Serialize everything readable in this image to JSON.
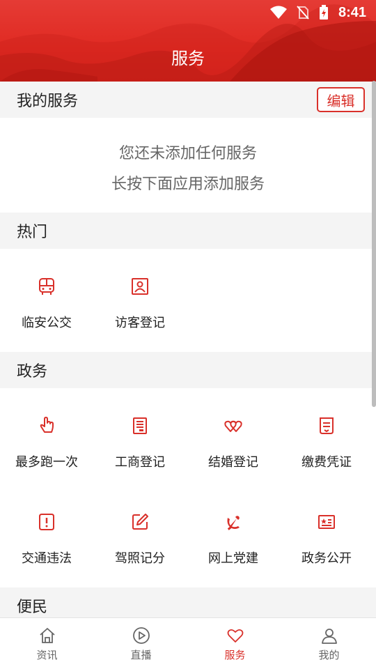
{
  "status": {
    "time": "8:41"
  },
  "header": {
    "title": "服务"
  },
  "my_services": {
    "title": "我的服务",
    "edit_label": "编辑",
    "empty_line1": "您还未添加任何服务",
    "empty_line2": "长按下面应用添加服务"
  },
  "hot": {
    "title": "热门",
    "items": [
      {
        "label": "临安公交",
        "icon": "bus-icon"
      },
      {
        "label": "访客登记",
        "icon": "visitor-card-icon"
      }
    ]
  },
  "gov": {
    "title": "政务",
    "items": [
      {
        "label": "最多跑一次",
        "icon": "tap-hand-icon"
      },
      {
        "label": "工商登记",
        "icon": "document-icon"
      },
      {
        "label": "结婚登记",
        "icon": "hearts-icon"
      },
      {
        "label": "缴费凭证",
        "icon": "receipt-icon"
      },
      {
        "label": "交通违法",
        "icon": "warning-doc-icon"
      },
      {
        "label": "驾照记分",
        "icon": "edit-icon"
      },
      {
        "label": "网上党建",
        "icon": "party-emblem-icon"
      },
      {
        "label": "政务公开",
        "icon": "star-board-icon"
      }
    ]
  },
  "convenience": {
    "title": "便民"
  },
  "nav": {
    "items": [
      {
        "label": "资讯",
        "icon": "home-icon"
      },
      {
        "label": "直播",
        "icon": "play-icon"
      },
      {
        "label": "服务",
        "icon": "heart-icon"
      },
      {
        "label": "我的",
        "icon": "user-icon"
      }
    ],
    "active_color": "#d9302a"
  },
  "colors": {
    "brand": "#e0291f",
    "accent": "#d9302a"
  }
}
